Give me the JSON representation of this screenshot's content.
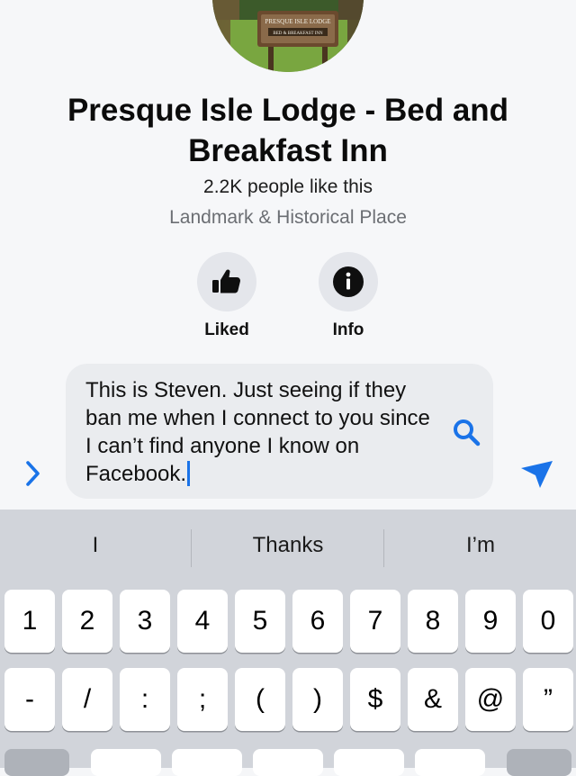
{
  "page": {
    "title": "Presque Isle Lodge - Bed and Breakfast Inn",
    "likes": "2.2K people like this",
    "category": "Landmark & Historical Place",
    "avatar": {
      "sign_line1": "PRESQUE ISLE LODGE",
      "sign_line2": "BED & BREAKFAST INN"
    },
    "actions": [
      {
        "label": "Liked",
        "icon": "thumbs-up-icon"
      },
      {
        "label": "Info",
        "icon": "info-icon"
      }
    ]
  },
  "composer": {
    "message": "This is Steven. Just seeing if they ban me when I connect to you since I can’t find anyone I know on Facebook.",
    "accent_color": "#1a73e8"
  },
  "keyboard": {
    "suggestions": [
      "I",
      "Thanks",
      "I’m"
    ],
    "row1": [
      "1",
      "2",
      "3",
      "4",
      "5",
      "6",
      "7",
      "8",
      "9",
      "0"
    ],
    "row2": [
      "-",
      "/",
      ":",
      ";",
      "(",
      ")",
      "$",
      "&",
      "@",
      "”"
    ]
  }
}
